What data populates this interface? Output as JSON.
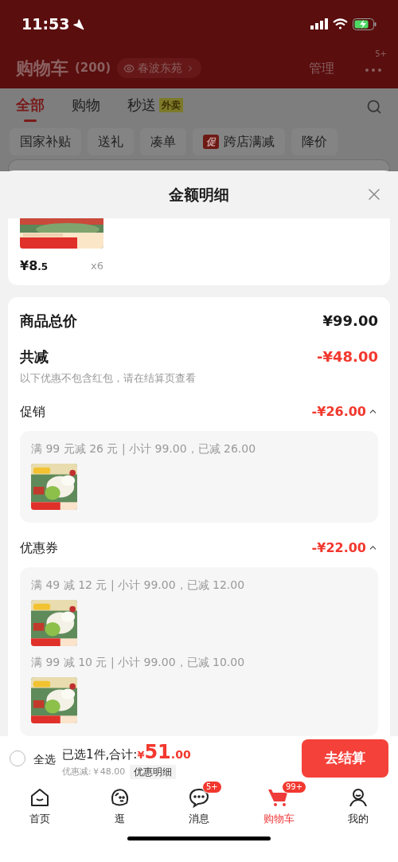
{
  "status_bar": {
    "time": "11:53"
  },
  "header": {
    "title": "购物车",
    "count": "(200)",
    "location": "春波东苑",
    "manage": "管理",
    "more_badge": "5+"
  },
  "tabs": [
    {
      "label": "全部",
      "selected": true
    },
    {
      "label": "购物",
      "selected": false
    },
    {
      "label": "秒送",
      "selected": false,
      "tag": "外卖"
    }
  ],
  "filters": [
    {
      "label": "国家补贴"
    },
    {
      "label": "送礼"
    },
    {
      "label": "凑单"
    },
    {
      "label": "跨店满减",
      "badge": "促"
    },
    {
      "label": "降价"
    }
  ],
  "sheet": {
    "title": "金额明细",
    "product": {
      "price": "¥8",
      "price_decimal": ".5",
      "quantity": "x6"
    },
    "total": {
      "label": "商品总价",
      "value": "¥99.00"
    },
    "reduction": {
      "label": "共减",
      "value": "-¥48.00",
      "note": "以下优惠不包含红包，请在结算页查看"
    },
    "groups": [
      {
        "title": "促销",
        "amount": "-¥26.00",
        "expanded": true,
        "rules": [
          {
            "text": "满 99 元减 26 元 | 小计 99.00，已减 26.00"
          }
        ]
      },
      {
        "title": "优惠券",
        "amount": "-¥22.00",
        "expanded": true,
        "rules": [
          {
            "text": "满 49 减 12 元 | 小计 99.00，已减 12.00"
          },
          {
            "text": "满 99 减 10 元 | 小计 99.00，已减 10.00"
          }
        ]
      }
    ]
  },
  "checkout_bar": {
    "select_all": {
      "label": "全选",
      "checked": false
    },
    "summary": "已选1件,合计:",
    "currency": "¥",
    "amount": "51",
    "amount_decimal": ".00",
    "discount": "优惠减:￥48.00",
    "detail_button": "优惠明细",
    "checkout_button": "去结算"
  },
  "nav": [
    {
      "label": "首页",
      "kind": "home",
      "selected": false
    },
    {
      "label": "逛",
      "kind": "browse",
      "selected": false
    },
    {
      "label": "消息",
      "kind": "messages",
      "selected": false,
      "badge": "5+"
    },
    {
      "label": "购物车",
      "kind": "cart",
      "selected": true,
      "badge": "99+"
    },
    {
      "label": "我的",
      "kind": "me",
      "selected": false
    }
  ]
}
